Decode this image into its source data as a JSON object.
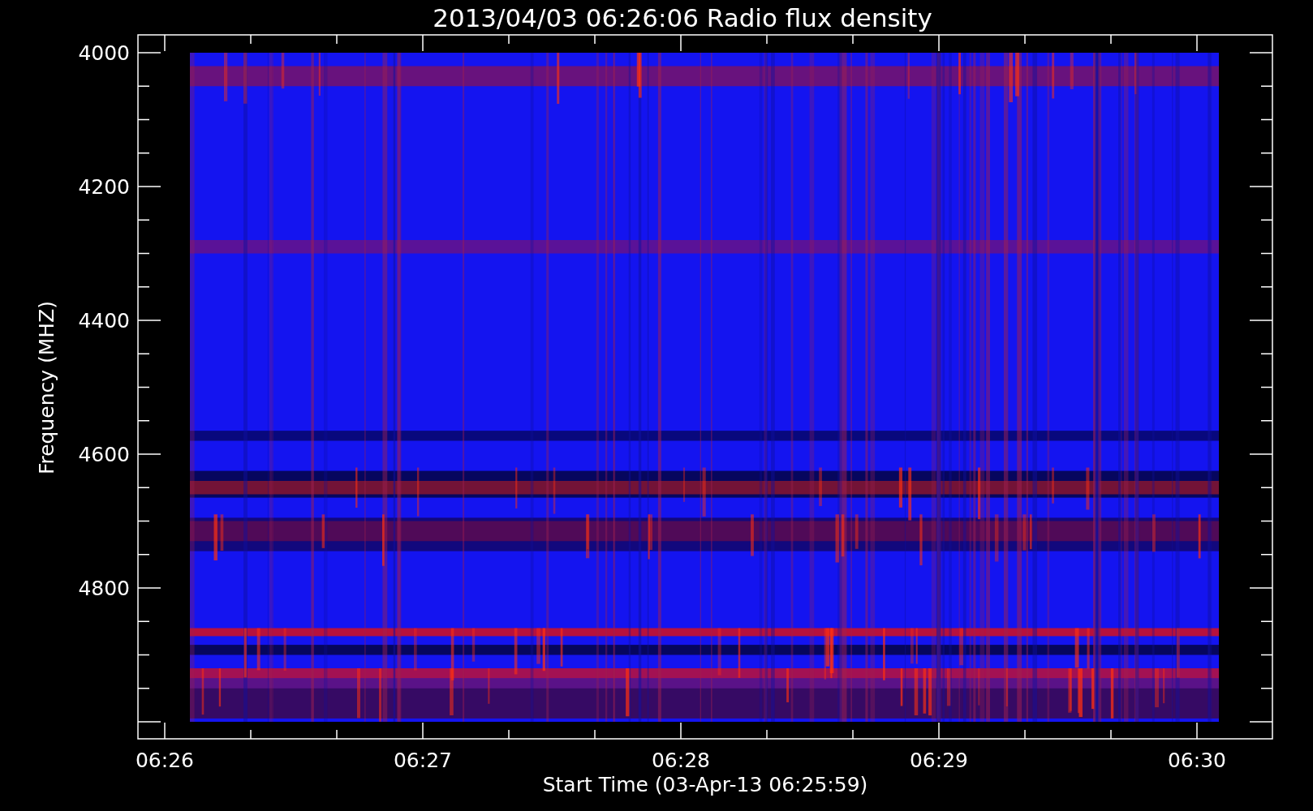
{
  "title": "2013/04/03 06:26:06 Radio flux density",
  "y_axis": {
    "label": "Frequency (MHZ)",
    "ticks": [
      "4000",
      "4200",
      "4400",
      "4600",
      "4800"
    ]
  },
  "x_axis": {
    "label": "Start Time (03-Apr-13 06:25:59)",
    "ticks": [
      "06:26",
      "06:27",
      "06:28",
      "06:29",
      "06:30"
    ]
  }
}
